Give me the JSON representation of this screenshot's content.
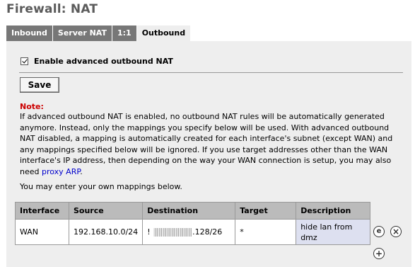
{
  "page": {
    "title": "Firewall: NAT"
  },
  "tabs": [
    {
      "label": "Inbound"
    },
    {
      "label": "Server NAT"
    },
    {
      "label": "1:1"
    },
    {
      "label": "Outbound"
    }
  ],
  "enable": {
    "label": "Enable advanced outbound NAT",
    "checked": true
  },
  "save_label": "Save",
  "note": {
    "label": "Note:",
    "text_before": "If advanced outbound NAT is enabled, no outbound NAT rules will be automatically generated anymore. Instead, only the mappings you specify below will be used. With advanced outbound NAT disabled, a mapping is automatically created for each interface's subnet (except WAN) and any mappings specified below will be ignored. If you use target addresses other than the WAN interface's IP address, then depending on the way your WAN connection is setup, you may also need ",
    "link": "proxy ARP",
    "text_after": "."
  },
  "mappings_text": "You may enter your own mappings below.",
  "table": {
    "headers": [
      "Interface",
      "Source",
      "Destination",
      "Target",
      "Description"
    ],
    "rows": [
      {
        "interface": "WAN",
        "source": "192.168.10.0/24",
        "destination_prefix": "!",
        "destination_suffix": ".128/26",
        "target": "*",
        "description": "hide lan from dmz"
      }
    ]
  },
  "icons": {
    "edit": "e",
    "delete": "×",
    "add": "+"
  }
}
